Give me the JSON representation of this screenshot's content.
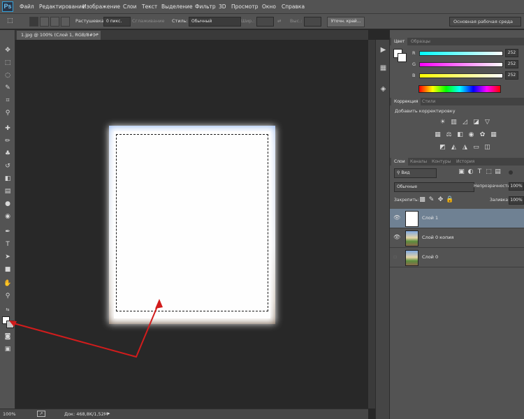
{
  "app": {
    "logo": "Ps"
  },
  "menu": [
    "Файл",
    "Редактирование",
    "Изображение",
    "Слои",
    "Текст",
    "Выделение",
    "Фильтр",
    "3D",
    "Просмотр",
    "Окно",
    "Справка"
  ],
  "options": {
    "feather_label": "Растушевка:",
    "feather_value": "0 пикс.",
    "antialias_label": "Сглаживание",
    "style_label": "Стиль:",
    "style_value": "Обычный",
    "width_label": "Шир.:",
    "height_label": "Выс.:",
    "refine_button": "Уточн. край..."
  },
  "workspace": {
    "label": "Основная рабочая среда"
  },
  "document": {
    "tab_title": "1.jpg @ 100% (Слой 1, RGB/8#) *"
  },
  "status": {
    "zoom": "100%",
    "doc_info": "Док: 468,8K/1,52M"
  },
  "color_panel": {
    "tabs": [
      "Цвет",
      "Образцы"
    ],
    "channels": [
      {
        "label": "R",
        "value": "252"
      },
      {
        "label": "G",
        "value": "252"
      },
      {
        "label": "B",
        "value": "252"
      }
    ]
  },
  "adjustments_panel": {
    "tabs": [
      "Коррекция",
      "Стили"
    ],
    "title": "Добавить корректировку"
  },
  "layers_panel": {
    "tabs": [
      "Слои",
      "Каналы",
      "Контуры",
      "История"
    ],
    "kind_filter": "Вид",
    "blend_mode": "Обычные",
    "opacity_label": "Непрозрачность:",
    "opacity_value": "100%",
    "lock_label": "Закрепить:",
    "fill_label": "Заливка:",
    "fill_value": "100%",
    "layers": [
      {
        "name": "Слой 1",
        "selected": true
      },
      {
        "name": "Слой 0 копия",
        "selected": false
      },
      {
        "name": "Слой 0",
        "selected": false
      }
    ]
  },
  "colors": {
    "accent_selected_layer": "#6f8193",
    "annotation_arrow": "#d21c1c"
  }
}
